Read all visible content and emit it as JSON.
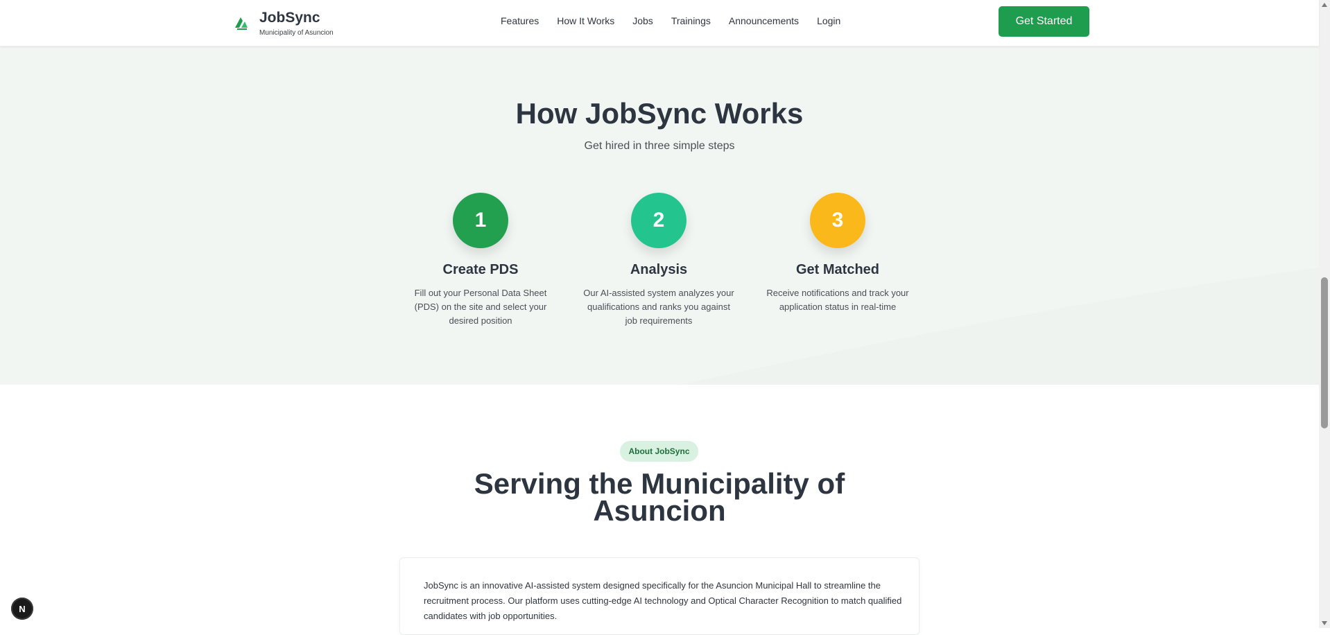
{
  "brand": {
    "name": "JobSync",
    "subtitle": "Municipality of Asuncion"
  },
  "nav": {
    "items": [
      "Features",
      "How It Works",
      "Jobs",
      "Trainings",
      "Announcements",
      "Login"
    ]
  },
  "cta": {
    "label": "Get Started"
  },
  "how_it_works": {
    "title": "How JobSync Works",
    "subtitle": "Get hired in three simple steps",
    "steps": [
      {
        "number": "1",
        "title": "Create PDS",
        "description": "Fill out your Personal Data Sheet (PDS) on the site and select your desired position",
        "color": "#22a050"
      },
      {
        "number": "2",
        "title": "Analysis",
        "description": "Our AI-assisted system analyzes your qualifications and ranks you against job requirements",
        "color": "#24c48f"
      },
      {
        "number": "3",
        "title": "Get Matched",
        "description": "Receive notifications and track your application status in real-time",
        "color": "#fbb81a"
      }
    ]
  },
  "about": {
    "badge": "About JobSync",
    "title": "Serving the Municipality of Asuncion",
    "body": "JobSync is an innovative AI-assisted system designed specifically for the Asuncion Municipal Hall to streamline the recruitment process. Our platform uses cutting-edge AI technology and Optical Character Recognition to match qualified candidates with job opportunities."
  },
  "dev_indicator": {
    "label": "N"
  },
  "colors": {
    "brand": "#1f9d4e",
    "section_bg": "#f1f6f3",
    "text": "#2d3540"
  }
}
